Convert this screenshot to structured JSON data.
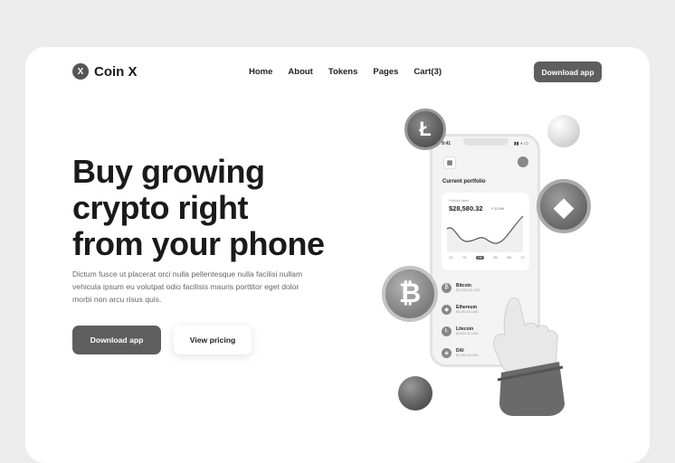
{
  "brand": {
    "logo_letter": "X",
    "name": "Coin X"
  },
  "nav": {
    "items": [
      "Home",
      "About",
      "Tokens",
      "Pages",
      "Cart(3)"
    ]
  },
  "header": {
    "download_label": "Download app"
  },
  "hero": {
    "title_lines": [
      "Buy growing",
      "crypto right",
      "from your phone"
    ],
    "subtitle": "Dictum fusce ut placerat orci nulla pellentesque nulla facilisi nullam vehicula ipsum eu volutpat odio facilisis mauris porttitor eget dolor morbi non arcu risus quis.",
    "primary_cta": "Download app",
    "secondary_cta": "View pricing"
  },
  "phone": {
    "time": "9:41",
    "section_title": "Current portfolio",
    "card_label": "Portfolio value",
    "portfolio_value": "$28,580.32",
    "change": "↗ 12.5%",
    "range_tabs": [
      "1D",
      "7D",
      "1M",
      "3M",
      "6M",
      "1Y"
    ],
    "active_tab": "1M",
    "assets": [
      {
        "name": "Bitcoin",
        "amount": "$12,580.32 USD",
        "icon": "bitcoin-icon",
        "glyph": "₿"
      },
      {
        "name": "Ethereum",
        "amount": "$5,250.00 USD",
        "icon": "ethereum-icon",
        "glyph": "◆"
      },
      {
        "name": "Litecoin",
        "amount": "$3,800.00 USD",
        "icon": "litecoin-icon",
        "glyph": "Ł"
      },
      {
        "name": "DAI",
        "amount": "$1,400.00 USD",
        "icon": "dai-icon",
        "glyph": "◈"
      }
    ]
  },
  "coins": {
    "litecoin": "Ł",
    "ethereum": "◆",
    "bitcoin": "₿"
  },
  "colors": {
    "primary_button": "#5e5e5e",
    "page_background": "#ececec",
    "card_background": "#ffffff"
  }
}
